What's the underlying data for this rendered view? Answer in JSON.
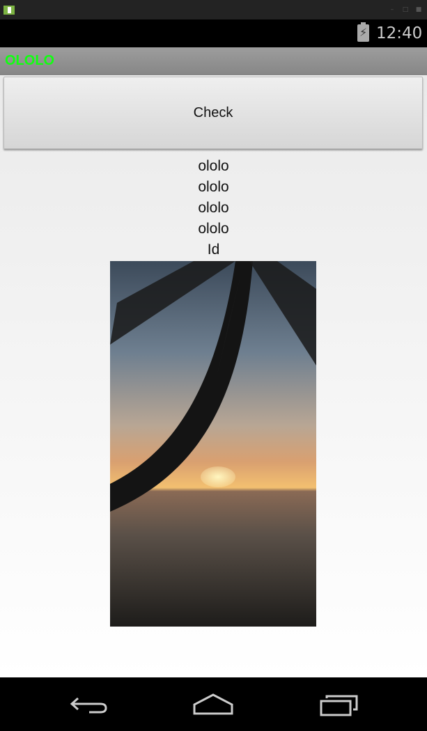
{
  "status_bar": {
    "time": "12:40",
    "battery_icon": "battery-charging-icon"
  },
  "action_bar": {
    "title": "OLOLO",
    "title_color": "#22ee22"
  },
  "main": {
    "check_button": "Check",
    "lines": [
      "ololo",
      "ololo",
      "ololo",
      "ololo",
      "Id"
    ],
    "image": "sunset-palm-beach-photo"
  },
  "nav_bar": {
    "back": "back-icon",
    "home": "home-icon",
    "recents": "recents-icon"
  }
}
